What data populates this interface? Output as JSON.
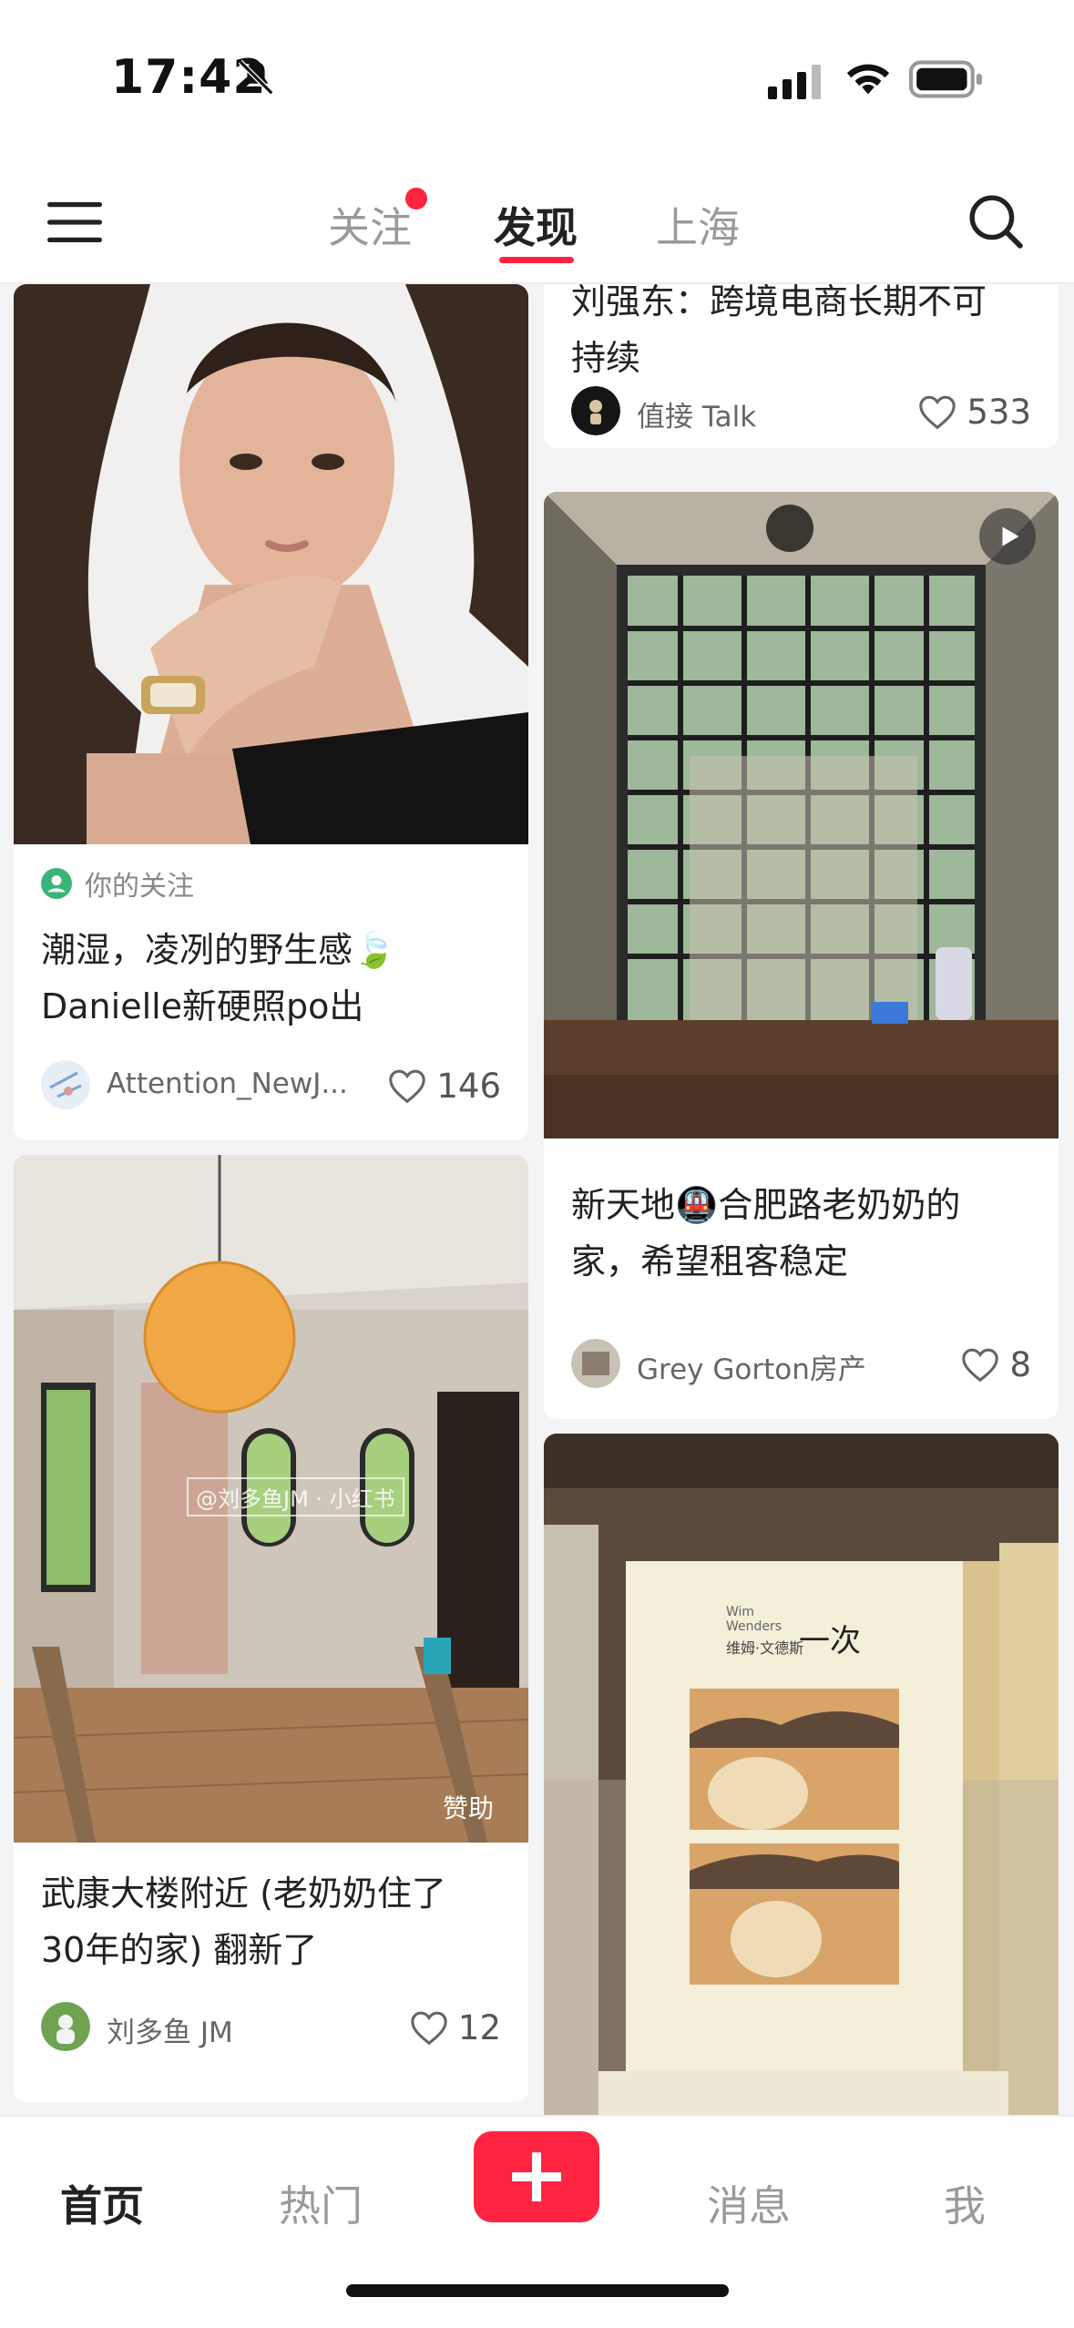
{
  "status_bar": {
    "time": "17:42"
  },
  "top_nav": {
    "tabs": [
      {
        "label": "关注",
        "active": false,
        "has_dot": true
      },
      {
        "label": "发现",
        "active": true
      },
      {
        "label": "上海",
        "active": false
      }
    ],
    "accent_color": "#ff2442"
  },
  "feed": {
    "left": [
      {
        "follow_tag": "你的关注",
        "title_line1": "潮湿，凌冽的野生感🍃",
        "title_line2": "Danielle新硬照po出",
        "author": "Attention_NewJ...",
        "likes": "146"
      },
      {
        "watermark": "@刘多鱼JM · 小红书",
        "sponsor": "赞助",
        "title_line1": "武康大楼附近 (老奶奶住了",
        "title_line2": "30年的家) 翻新了",
        "author": "刘多鱼 JM",
        "likes": "12"
      }
    ],
    "right": [
      {
        "title_line1": "刘强东：跨境电商长期不可",
        "title_line2": "持续",
        "author": "值接 Talk",
        "likes": "533"
      },
      {
        "title_line1": "新天地🚇合肥路老奶奶的",
        "title_line2": "家，希望租客稳定",
        "author": "Grey Gorton房产",
        "likes": "8"
      },
      {
        "book_title": "一次",
        "book_author": "维姆·文德斯",
        "book_en": "Wim Wenders"
      }
    ]
  },
  "bottom_nav": {
    "home": "首页",
    "hot": "热门",
    "plus": "+",
    "messages": "消息",
    "me": "我"
  }
}
